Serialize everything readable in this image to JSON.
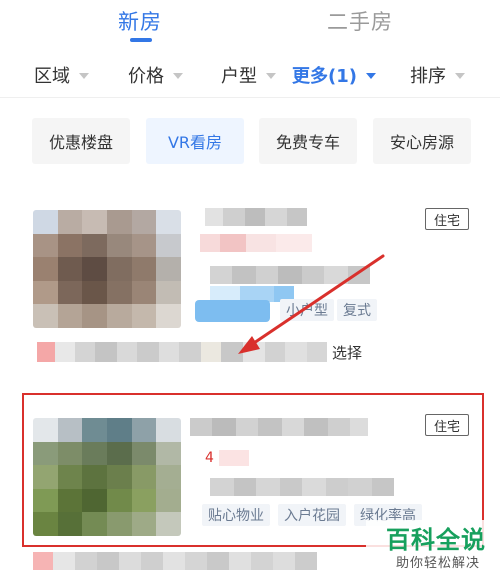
{
  "top_tabs": [
    {
      "label": "新房",
      "active": true
    },
    {
      "label": "二手房",
      "active": false
    }
  ],
  "filters": [
    {
      "label": "区域"
    },
    {
      "label": "价格"
    },
    {
      "label": "户型"
    },
    {
      "label": "更多(1)",
      "active": true
    },
    {
      "label": "排序"
    }
  ],
  "quick_tags": [
    {
      "label": "优惠楼盘"
    },
    {
      "label": "VR看房",
      "active": true
    },
    {
      "label": "免费专车"
    },
    {
      "label": "安心房源"
    }
  ],
  "listings": [
    {
      "type_badge": "住宅",
      "feature_tags": [
        "小户型",
        "复式"
      ],
      "trailing_text": "选择"
    },
    {
      "type_badge": "住宅",
      "price_fragment": "4",
      "feature_tags": [
        "贴心物业",
        "入户花园",
        "绿化率高"
      ]
    }
  ],
  "watermark": {
    "title": "百科全说",
    "subtitle": "助你轻松解决"
  },
  "colors": {
    "accent": "#3377e6",
    "highlight_border": "#d9302c",
    "watermark_green": "#17a05d"
  }
}
